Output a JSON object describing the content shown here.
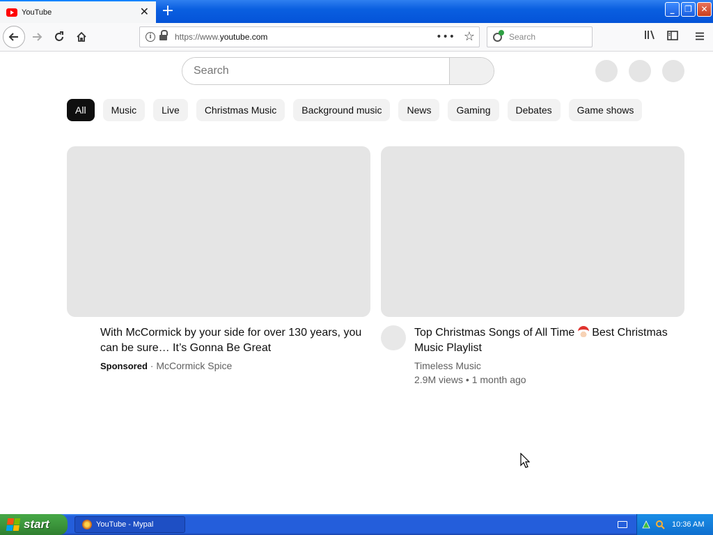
{
  "browser": {
    "tab_title": "YouTube",
    "url_prefix": "https://www.",
    "url_domain": "youtube.com",
    "search_placeholder": "Search"
  },
  "youtube": {
    "search_placeholder": "Search",
    "chips": [
      "All",
      "Music",
      "Live",
      "Christmas Music",
      "Background music",
      "News",
      "Gaming",
      "Debates",
      "Game shows"
    ],
    "videos": [
      {
        "title": "With McCormick by your side for over 130 years, you can be sure… It’s Gonna Be Great",
        "sponsored_label": "Sponsored",
        "channel": "McCormick Spice"
      },
      {
        "title_before_emoji": "Top Christmas Songs of All Time",
        "title_after_emoji": "Best Christmas Music Playlist",
        "channel": "Timeless Music",
        "views": "2.9M views",
        "age": "1 month ago"
      }
    ]
  },
  "taskbar": {
    "start_label": "start",
    "window_label": "YouTube - Mypal",
    "clock": "10:36 AM"
  },
  "colors": {
    "chip_active_bg": "#0f0f0f",
    "placeholder_gray": "#e5e5e5",
    "xp_blue": "#245edb",
    "start_green": "#3c963c"
  }
}
